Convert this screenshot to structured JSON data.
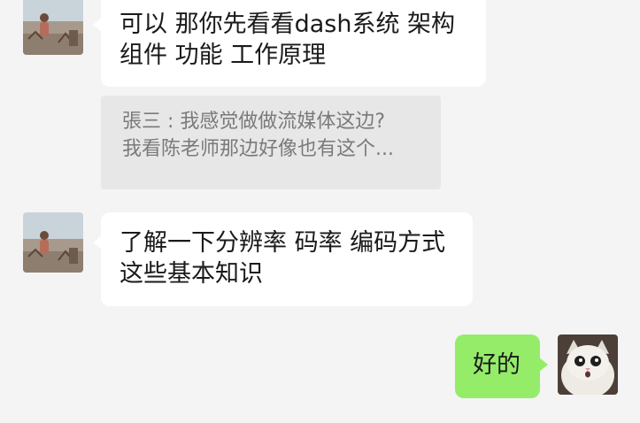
{
  "messages": [
    {
      "sender": "other",
      "avatar_icon": "person-photo-avatar",
      "lines": [
        "可以 那你先看看dash系统 架构",
        "组件 功能 工作原理"
      ]
    },
    {
      "sender": "quote",
      "lines": [
        "張三 : 我感觉做做流媒体这边?",
        "我看陈老师那边好像也有这个..."
      ]
    },
    {
      "sender": "other",
      "avatar_icon": "person-photo-avatar",
      "lines": [
        "了解一下分辨率 码率 编码方式",
        "这些基本知识"
      ]
    },
    {
      "sender": "self",
      "avatar_icon": "cat-photo-avatar",
      "lines": [
        "好的"
      ]
    }
  ],
  "colors": {
    "background": "#f4f4f4",
    "incoming_bubble": "#ffffff",
    "outgoing_bubble": "#95ec69",
    "quote_bg": "#e7e7e7",
    "quote_text": "#7a7a7a"
  }
}
